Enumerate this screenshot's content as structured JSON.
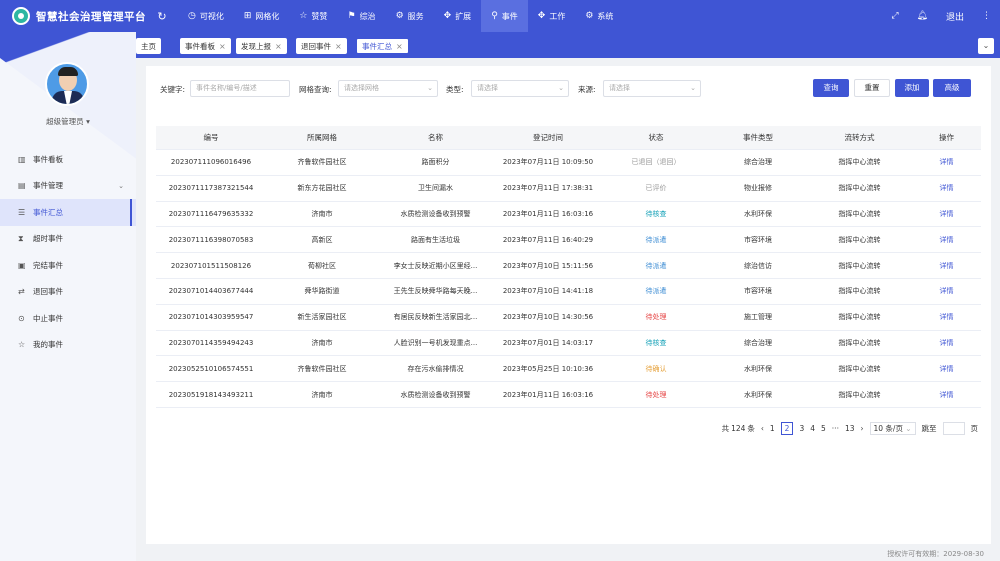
{
  "app": {
    "title": "智慧社会治理管理平台"
  },
  "topnav": {
    "items": [
      {
        "label": "可视化",
        "icon": "◷"
      },
      {
        "label": "网格化",
        "icon": "⊞"
      },
      {
        "label": "赞赞",
        "icon": "☆"
      },
      {
        "label": "综治",
        "icon": "⚑"
      },
      {
        "label": "服务",
        "icon": "⚙"
      },
      {
        "label": "扩展",
        "icon": "✥"
      },
      {
        "label": "事件",
        "icon": "⚲"
      },
      {
        "label": "工作",
        "icon": "✥"
      },
      {
        "label": "系统",
        "icon": "⚙"
      }
    ],
    "active_index": 6,
    "logout": "退出"
  },
  "tabs": [
    {
      "label": "主页",
      "closable": false
    },
    {
      "label": "事件看板",
      "closable": true
    },
    {
      "label": "发现上报",
      "closable": true
    },
    {
      "label": "退回事件",
      "closable": true
    },
    {
      "label": "事件汇总",
      "closable": true
    }
  ],
  "user": {
    "name": "超级管理员"
  },
  "sidebar": {
    "items": [
      {
        "label": "事件看板",
        "icon": "▥"
      },
      {
        "label": "事件管理",
        "icon": "▤"
      },
      {
        "label": "事件汇总",
        "icon": "☰"
      },
      {
        "label": "超时事件",
        "icon": "⧗"
      },
      {
        "label": "完结事件",
        "icon": "▣"
      },
      {
        "label": "退回事件",
        "icon": "⇄"
      },
      {
        "label": "中止事件",
        "icon": "⊙"
      },
      {
        "label": "我的事件",
        "icon": "☆"
      }
    ]
  },
  "filters": {
    "keyword_label": "关键字:",
    "keyword_placeholder": "事件名称/编号/描述",
    "grid_label": "网格查询:",
    "grid_placeholder": "请选择网格",
    "type_label": "类型:",
    "type_placeholder": "请选择",
    "source_label": "来源:",
    "source_placeholder": "请选择"
  },
  "buttons": {
    "query": "查询",
    "reset": "重置",
    "add": "添加",
    "advanced": "高级"
  },
  "table": {
    "headers": [
      "编号",
      "所属网格",
      "名称",
      "登记时间",
      "状态",
      "事件类型",
      "流转方式",
      "操作"
    ],
    "rows": [
      [
        "20230711109601649​6",
        "齐鲁软件园社区",
        "路面积分",
        "2023年07月11日 10:09:50",
        "已退回（退回）",
        "综合治理",
        "指挥中心流转",
        "详情"
      ],
      [
        "20230711173873215​44",
        "新东方花园社区",
        "卫生间漏水",
        "2023年07月11日 17:38:31",
        "已评价",
        "物业报修",
        "指挥中心流转",
        "详情"
      ],
      [
        "20230711164796353​32",
        "济南市",
        "水质检测设备收到预警",
        "2023年01月11日 16:03:16",
        "待核查",
        "水利环保",
        "指挥中心流转",
        "详情"
      ],
      [
        "20230711163980705​83",
        "高新区",
        "路面有生活垃圾",
        "2023年07月11日 16:40:29",
        "待派遣",
        "市容环境",
        "指挥中心流转",
        "详情"
      ],
      [
        "20230710151150812​6",
        "荀柳社区",
        "李女士反映近期小区里经...",
        "2023年07月10日 15:11:56",
        "待派遣",
        "综治信访",
        "指挥中心流转",
        "详情"
      ],
      [
        "20230710144036774​44",
        "舜华路街道",
        "王先生反映舜华路每天晚...",
        "2023年07月10日 14:41:18",
        "待派遣",
        "市容环境",
        "指挥中心流转",
        "详情"
      ],
      [
        "20230710143039595​47",
        "新生活家园社区",
        "有居民反映新生活家园北...",
        "2023年07月10日 14:30:56",
        "待处理",
        "施工管理",
        "指挥中心流转",
        "详情"
      ],
      [
        "20230701143594942​43",
        "济南市",
        "人脸识别一号机发现重点...",
        "2023年07月01日 14:03:17",
        "待核查",
        "综合治理",
        "指挥中心流转",
        "详情"
      ],
      [
        "20230525101065745​51",
        "齐鲁软件园社区",
        "存在污水偷排情况",
        "2023年05月25日 10:10:36",
        "待确认",
        "水利环保",
        "指挥中心流转",
        "详情"
      ],
      [
        "20230519181434932​11",
        "济南市",
        "水质检测设备收到预警",
        "2023年01月11日 16:03:16",
        "待处理",
        "水利环保",
        "指挥中心流转",
        "详情"
      ]
    ],
    "status_colors": {
      "已退回（退回）": "#999999",
      "已评价": "#999999",
      "待核查": "#17a2b8",
      "待派遣": "#3f8ed4",
      "待处理": "#e64545",
      "待确认": "#e6a23c"
    }
  },
  "pagination": {
    "total_prefix": "共",
    "total": "124",
    "total_suffix": "条",
    "prev": "‹",
    "next": "›",
    "pages": [
      "1",
      "2",
      "3",
      "4",
      "5",
      "···",
      "13"
    ],
    "current_page": "2",
    "page_size": "10 条/页",
    "jump_prefix": "跳至",
    "jump_suffix": "页"
  },
  "footer": {
    "text": "授权许可有效期：2029-08-30"
  },
  "colors": {
    "primary": "#3f55d4"
  }
}
